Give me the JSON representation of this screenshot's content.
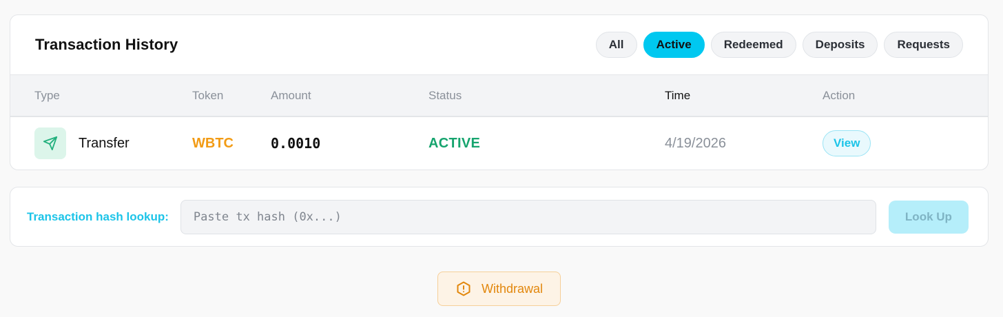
{
  "history": {
    "title": "Transaction History",
    "tabs": [
      {
        "label": "All",
        "active": false
      },
      {
        "label": "Active",
        "active": true
      },
      {
        "label": "Redeemed",
        "active": false
      },
      {
        "label": "Deposits",
        "active": false
      },
      {
        "label": "Requests",
        "active": false
      }
    ],
    "columns": {
      "type": "Type",
      "token": "Token",
      "amount": "Amount",
      "status": "Status",
      "time": "Time",
      "action": "Action"
    },
    "rows": [
      {
        "type_icon": "send-icon",
        "type": "Transfer",
        "token": "WBTC",
        "amount": "0.0010",
        "status": "ACTIVE",
        "time": "4/19/2026",
        "action": "View"
      }
    ]
  },
  "lookup": {
    "label": "Transaction hash lookup:",
    "placeholder": "Paste tx hash (0x...)",
    "value": "",
    "button_label": "Look Up"
  },
  "withdrawal": {
    "icon": "alert-hexagon-icon",
    "label": "Withdrawal"
  },
  "colors": {
    "accent": "#00c8f0",
    "token": "#f29b14",
    "status_active": "#16a46e",
    "warning": "#e2870c"
  }
}
